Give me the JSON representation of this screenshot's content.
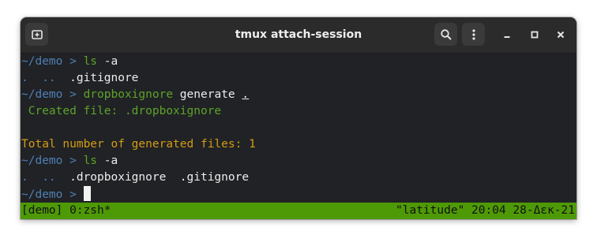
{
  "window": {
    "title": "tmux attach-session",
    "buttons": [
      "new-tab",
      "search",
      "menu",
      "minimize",
      "maximize",
      "close"
    ]
  },
  "terminal": {
    "lines": [
      {
        "prompt": "~/demo > ",
        "cmd": "ls",
        "args": " -a"
      },
      {
        "output_dots": ".  ..  ",
        "output_file": ".gitignore"
      },
      {
        "prompt": "~/demo > ",
        "cmd": "dropboxignore",
        "args": " generate ",
        "arg_path": "."
      },
      {
        "output": " Created file: .dropboxignore"
      },
      {
        "output": ""
      },
      {
        "output": "Total number of generated files: 1"
      },
      {
        "prompt": "~/demo > ",
        "cmd": "ls",
        "args": " -a"
      },
      {
        "output_dots": ".  ..  ",
        "output_file": ".dropboxignore  .gitignore"
      },
      {
        "prompt": "~/demo > "
      }
    ]
  },
  "statusbar": {
    "left": "[demo] 0:zsh*",
    "right": "\"latitude\" 20:04 28-Δεκ-21"
  },
  "colors": {
    "prompt": "#4f7fb4",
    "command": "#5ea32a",
    "success": "#5ea32a",
    "summary": "#d49c14",
    "statusbar_bg": "#4e9a06"
  }
}
